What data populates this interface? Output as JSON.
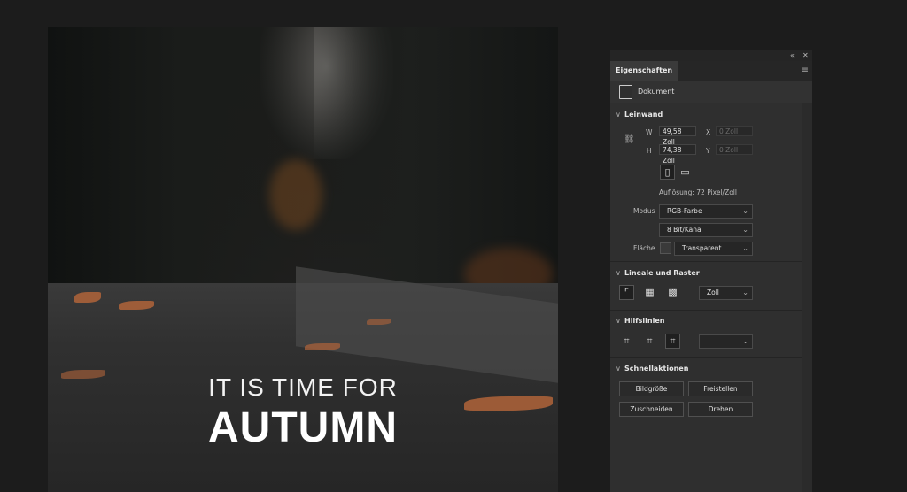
{
  "artwork": {
    "line1": "IT IS TIME FOR",
    "line2": "AUTUMN"
  },
  "panel": {
    "collapse_icon": "double-chevron-icon",
    "close_icon": "close-icon",
    "tab_label": "Eigenschaften",
    "menu_icon": "hamburger-icon",
    "document_label": "Dokument",
    "canvas": {
      "title": "Leinwand",
      "w_label": "W",
      "w_value": "49,58 Zoll",
      "h_label": "H",
      "h_value": "74,38 Zoll",
      "x_label": "X",
      "x_value": "0 Zoll",
      "y_label": "Y",
      "y_value": "0 Zoll",
      "resolution": "Auflösung: 72 Pixel/Zoll",
      "mode_label": "Modus",
      "mode_value": "RGB-Farbe",
      "depth_value": "8 Bit/Kanal",
      "fill_label": "Fläche",
      "fill_value": "Transparent"
    },
    "rulers": {
      "title": "Lineale und Raster",
      "unit_value": "Zoll"
    },
    "guides": {
      "title": "Hilfslinien"
    },
    "quick": {
      "title": "Schnellaktionen",
      "btn1": "Bildgröße",
      "btn2": "Freistellen",
      "btn3": "Zuschneiden",
      "btn4": "Drehen"
    }
  },
  "colors": {
    "panel_bg": "#2f2f2f",
    "app_bg": "#1c1c1c"
  }
}
